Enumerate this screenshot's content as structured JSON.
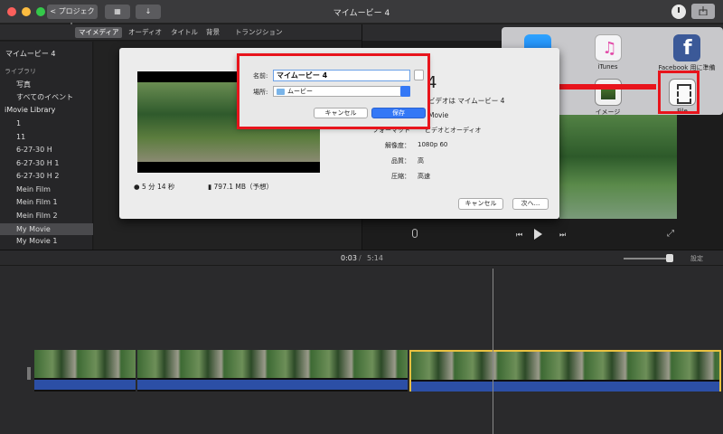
{
  "window": {
    "title": "マイムービー 4",
    "back_label": "< プロジェクト"
  },
  "tabs": [
    "マイメディア",
    "オーディオ",
    "タイトル",
    "背景",
    "トランジション"
  ],
  "sidebar": {
    "project": "マイムービー 4",
    "library_section": "ライブラリ",
    "library_items": [
      "写真",
      "すべてのイベント"
    ],
    "imovie_library": "iMovie Library",
    "events": [
      "1",
      "11",
      "6-27-30 H",
      "6-27-30 H 1",
      "6-27-30 H 2",
      "Mein Film",
      "Mein Film 1",
      "Mein Film 2",
      "My Movie",
      "My Movie 1"
    ],
    "selected": "My Movie"
  },
  "share_menu": {
    "items": [
      {
        "label": "",
        "icon": "mail-icon"
      },
      {
        "label": "iTunes",
        "icon": "itunes-icon"
      },
      {
        "label": "Facebook 用に準備",
        "icon": "facebook-icon"
      },
      {
        "label": "イメージ",
        "icon": "image-icon"
      },
      {
        "label": "File",
        "icon": "file-icon"
      }
    ]
  },
  "export_dialog": {
    "title_partial": "4",
    "description": "ビデオは マイムービー 4",
    "kind": "Movie",
    "format_label": "フォーマット",
    "format_value": "ビデオとオーディオ",
    "resolution_label": "解像度：",
    "resolution_value": "1080p 60",
    "quality_label": "品質：",
    "quality_value": "高",
    "compress_label": "圧縮：",
    "compress_value": "高速",
    "duration": "5 分 14 秒",
    "filesize": "797.1 MB（予想）",
    "cancel_label": "キャンセル",
    "next_label": "次へ..."
  },
  "save_sheet": {
    "name_label": "名前:",
    "name_value": "マイムービー 4",
    "location_label": "場所:",
    "location_value": "ムービー",
    "cancel_label": "キャンセル",
    "save_label": "保存"
  },
  "timeline": {
    "current": "0:03",
    "separator": "/",
    "total": "5:14",
    "settings_label": "設定"
  },
  "colors": {
    "accent_blue": "#3478f6",
    "highlight_red": "#e8141c",
    "selection_yellow": "#e8c040"
  }
}
